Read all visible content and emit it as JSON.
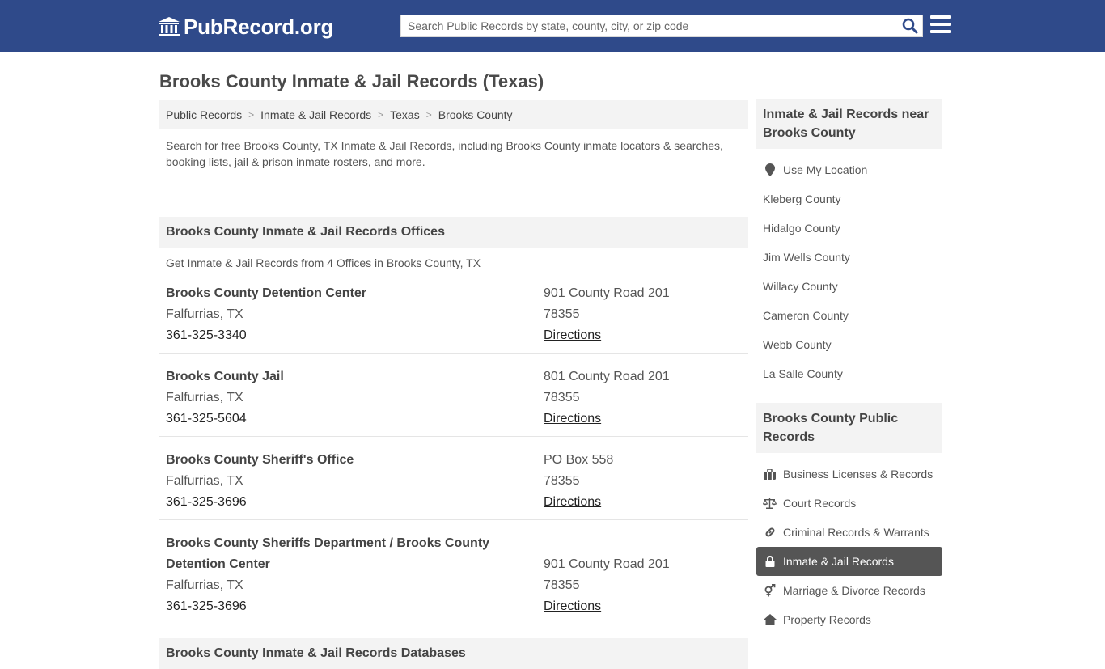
{
  "header": {
    "logo_text": "PubRecord.org",
    "search_placeholder": "Search Public Records by state, county, city, or zip code",
    "search_value": ""
  },
  "page": {
    "title": "Brooks County Inmate & Jail Records (Texas)"
  },
  "breadcrumb": [
    {
      "label": "Public Records"
    },
    {
      "label": "Inmate & Jail Records"
    },
    {
      "label": "Texas"
    },
    {
      "label": "Brooks County"
    }
  ],
  "intro": "Search for free Brooks County, TX Inmate & Jail Records, including Brooks County inmate locators & searches, booking lists, jail & prison inmate rosters, and more.",
  "offices_section": {
    "heading": "Brooks County Inmate & Jail Records Offices",
    "subtitle": "Get Inmate & Jail Records from 4 Offices in Brooks County, TX",
    "offices": [
      {
        "name": "Brooks County Detention Center",
        "city": "Falfurrias, TX",
        "phone": "361-325-3340",
        "address": "901 County Road 201",
        "zip": "78355",
        "directions": "Directions"
      },
      {
        "name": "Brooks County Jail",
        "city": "Falfurrias, TX",
        "phone": "361-325-5604",
        "address": "801 County Road 201",
        "zip": "78355",
        "directions": "Directions"
      },
      {
        "name": "Brooks County Sheriff's Office",
        "city": "Falfurrias, TX",
        "phone": "361-325-3696",
        "address": "PO Box 558",
        "zip": "78355",
        "directions": "Directions"
      },
      {
        "name": "Brooks County Sheriffs Department / Brooks County Detention Center",
        "city": "Falfurrias, TX",
        "phone": "361-325-3696",
        "address": "901 County Road 201",
        "zip": "78355",
        "directions": "Directions"
      }
    ]
  },
  "databases_section": {
    "heading": "Brooks County Inmate & Jail Records Databases"
  },
  "sidebar": {
    "nearby": {
      "heading": "Inmate & Jail Records near Brooks County",
      "use_location": "Use My Location",
      "counties": [
        "Kleberg County",
        "Hidalgo County",
        "Jim Wells County",
        "Willacy County",
        "Cameron County",
        "Webb County",
        "La Salle County"
      ]
    },
    "public_records": {
      "heading": "Brooks County Public Records",
      "items": [
        {
          "label": "Business Licenses & Records",
          "icon": "briefcase-icon",
          "active": false
        },
        {
          "label": "Court Records",
          "icon": "scales-icon",
          "active": false
        },
        {
          "label": "Criminal Records & Warrants",
          "icon": "link-icon",
          "active": false
        },
        {
          "label": "Inmate & Jail Records",
          "icon": "lock-icon",
          "active": true
        },
        {
          "label": "Marriage & Divorce Records",
          "icon": "gender-icon",
          "active": false
        },
        {
          "label": "Property Records",
          "icon": "home-icon",
          "active": false
        }
      ]
    }
  },
  "colors": {
    "header_bg": "#2f4a8a",
    "section_bg": "#f3f3f3",
    "active_item_bg": "#555555",
    "search_icon": "#2f4a8a"
  }
}
